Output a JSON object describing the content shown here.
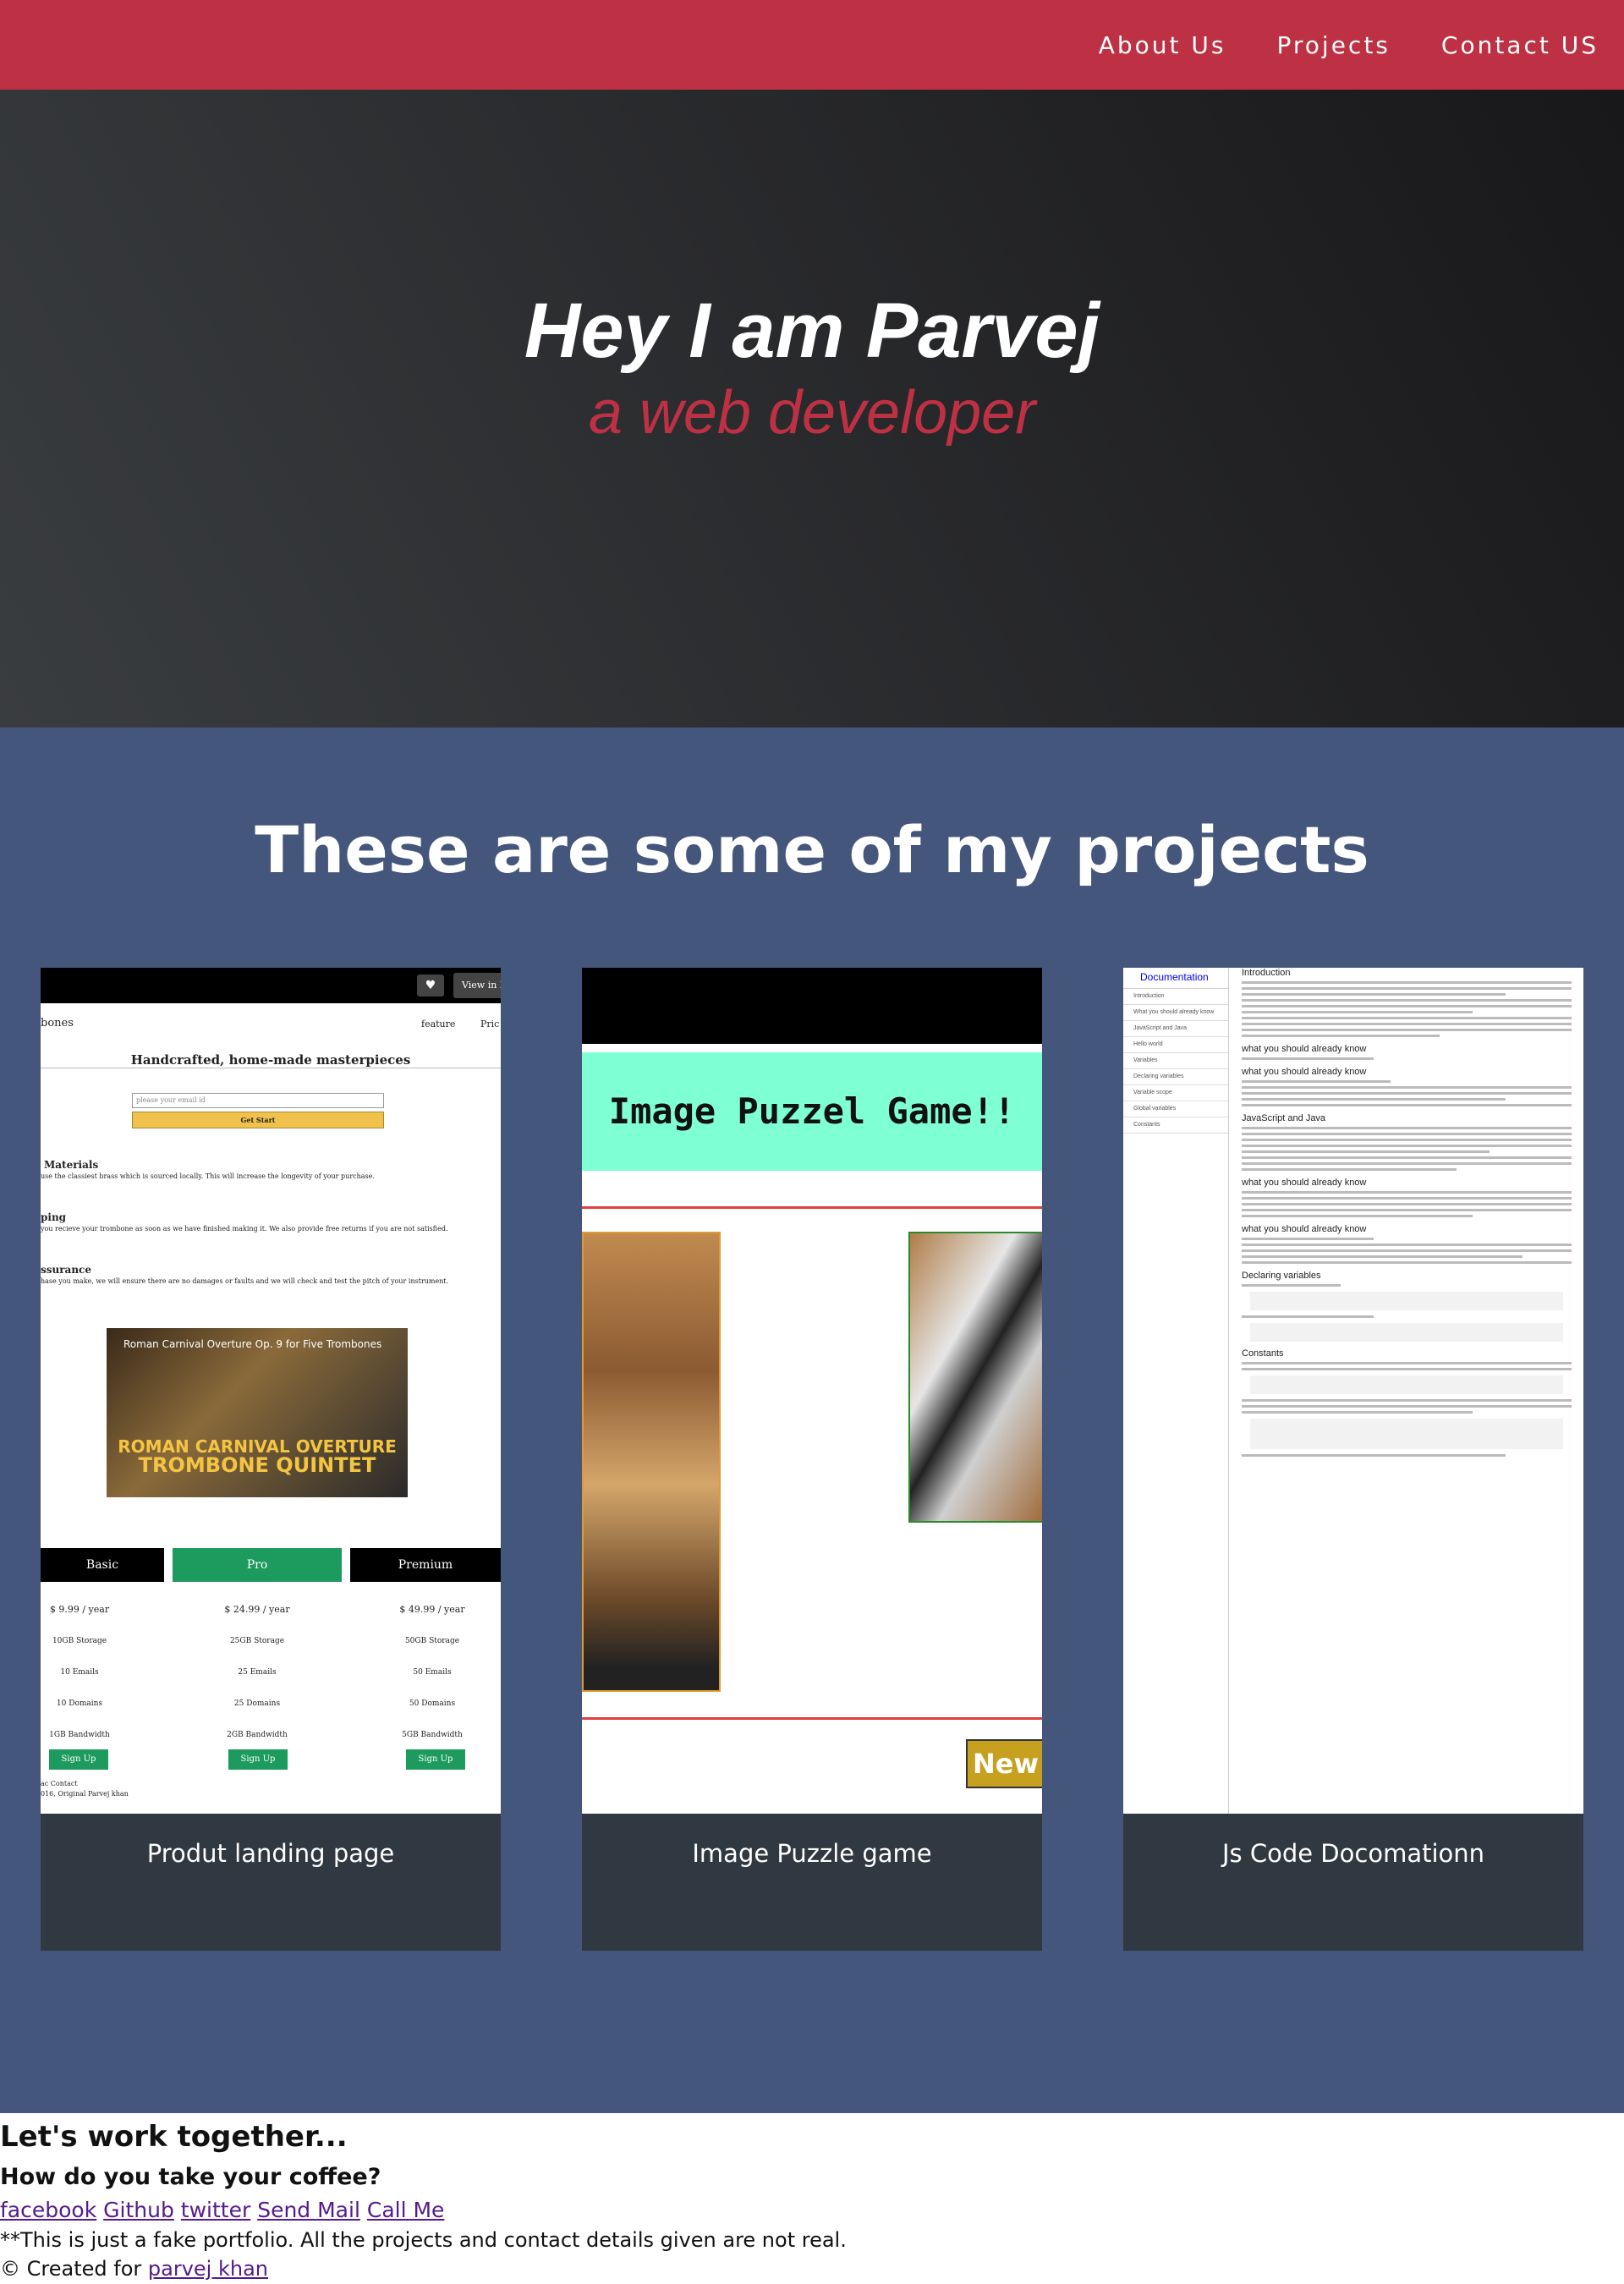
{
  "nav": {
    "links": [
      "About Us",
      "Projects",
      "Contact US"
    ]
  },
  "hero": {
    "title": "Hey I am Parvej",
    "subtitle": "a web developer"
  },
  "projects": {
    "heading": "These are some of my projects",
    "tiles": [
      {
        "title": "Produt landing page",
        "shot": {
          "view_button": "View in Edi",
          "brand": "bones",
          "nav": [
            "feature",
            "Pric"
          ],
          "headline": "Handcrafted, home-made masterpieces",
          "email_placeholder": "please your email id",
          "start_button": "Get Start",
          "features": [
            {
              "title": "Materials",
              "text": "use the classiest brass which is sourced locally. This will increase the longevity of your purchase."
            },
            {
              "title": "ping",
              "text": "you recieve your trombone as soon as we have finished making it. We also provide free returns if you are not satisfied."
            },
            {
              "title": "ssurance",
              "text": "hase you make, we will ensure there are no damages or faults and we will check and test the pitch of your instrument."
            }
          ],
          "video_title": "Roman Carnival Overture Op. 9 for Five Trombones",
          "video_big_1": "ROMAN CARNIVAL OVERTURE",
          "video_big_2": "TROMBONE QUINTET",
          "plans": [
            {
              "name": "Basic",
              "price": "$ 9.99 / year",
              "rows": [
                "10GB Storage",
                "10 Emails",
                "10 Domains",
                "1GB Bandwidth"
              ],
              "cta": "Sign Up",
              "color": "#000000"
            },
            {
              "name": "Pro",
              "price": "$ 24.99 / year",
              "rows": [
                "25GB Storage",
                "25 Emails",
                "25 Domains",
                "2GB Bandwidth"
              ],
              "cta": "Sign Up",
              "color": "#1d9b5e"
            },
            {
              "name": "Premium",
              "price": "$ 49.99 / year",
              "rows": [
                "50GB Storage",
                "50 Emails",
                "50 Domains",
                "5GB Bandwidth"
              ],
              "cta": "Sign Up",
              "color": "#000000"
            }
          ],
          "footer_1": "ac Contact",
          "footer_2": "016, Original Parvej khan"
        }
      },
      {
        "title": "Image Puzzle game",
        "shot": {
          "banner": "Image Puzzel Game!!",
          "badge": "New"
        }
      },
      {
        "title": "Js Code Docomationn",
        "shot": {
          "sidebar_title": "Documentation",
          "sidebar_items": [
            "Introduction",
            "What you should already know",
            "JavaScript and Java",
            "Hello world",
            "Variables",
            "Declaring variables",
            "Variable scope",
            "Global variables",
            "Constants"
          ],
          "sections": [
            "Introduction",
            "what you should already know",
            "what you should already know",
            "JavaScript and Java",
            "what you should already know",
            "what you should already know",
            "Declaring variables",
            "Constants"
          ]
        }
      }
    ]
  },
  "footer": {
    "heading": "Let's work together...",
    "subheading": "How do you take your coffee?",
    "links": [
      "facebook",
      "Github",
      "twitter",
      "Send Mail",
      "Call Me"
    ],
    "disclaimer": "**This is just a fake portfolio. All the projects and contact details given are not real.",
    "credit_prefix": "© Created for",
    "credit_link": "parvej khan"
  }
}
